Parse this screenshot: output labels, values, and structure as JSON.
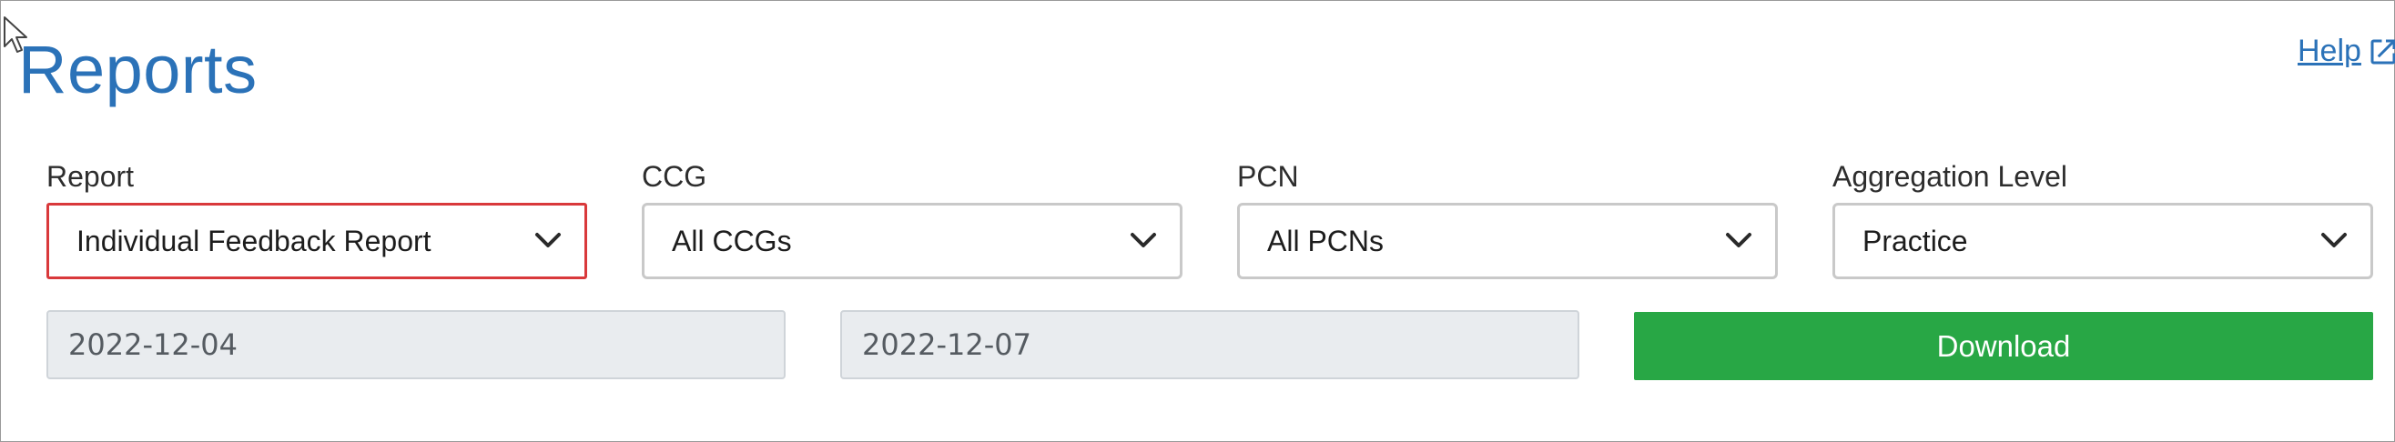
{
  "page": {
    "title": "Reports",
    "help_label": "Help"
  },
  "filters": {
    "report": {
      "label": "Report",
      "value": "Individual Feedback Report"
    },
    "ccg": {
      "label": "CCG",
      "value": "All CCGs"
    },
    "pcn": {
      "label": "PCN",
      "value": "All PCNs"
    },
    "aggregation": {
      "label": "Aggregation Level",
      "value": "Practice"
    }
  },
  "dates": {
    "start": "2022-12-04",
    "end": "2022-12-07"
  },
  "actions": {
    "download_label": "Download"
  },
  "colors": {
    "title": "#2b72b8",
    "link": "#2b72b8",
    "download_bg": "#28a745",
    "highlight_border": "#d9393b",
    "date_bg": "#e9ecef"
  },
  "icons": {
    "cursor": "mouse-pointer-icon",
    "help": "external-link-icon",
    "dropdown": "chevron-down-icon"
  }
}
